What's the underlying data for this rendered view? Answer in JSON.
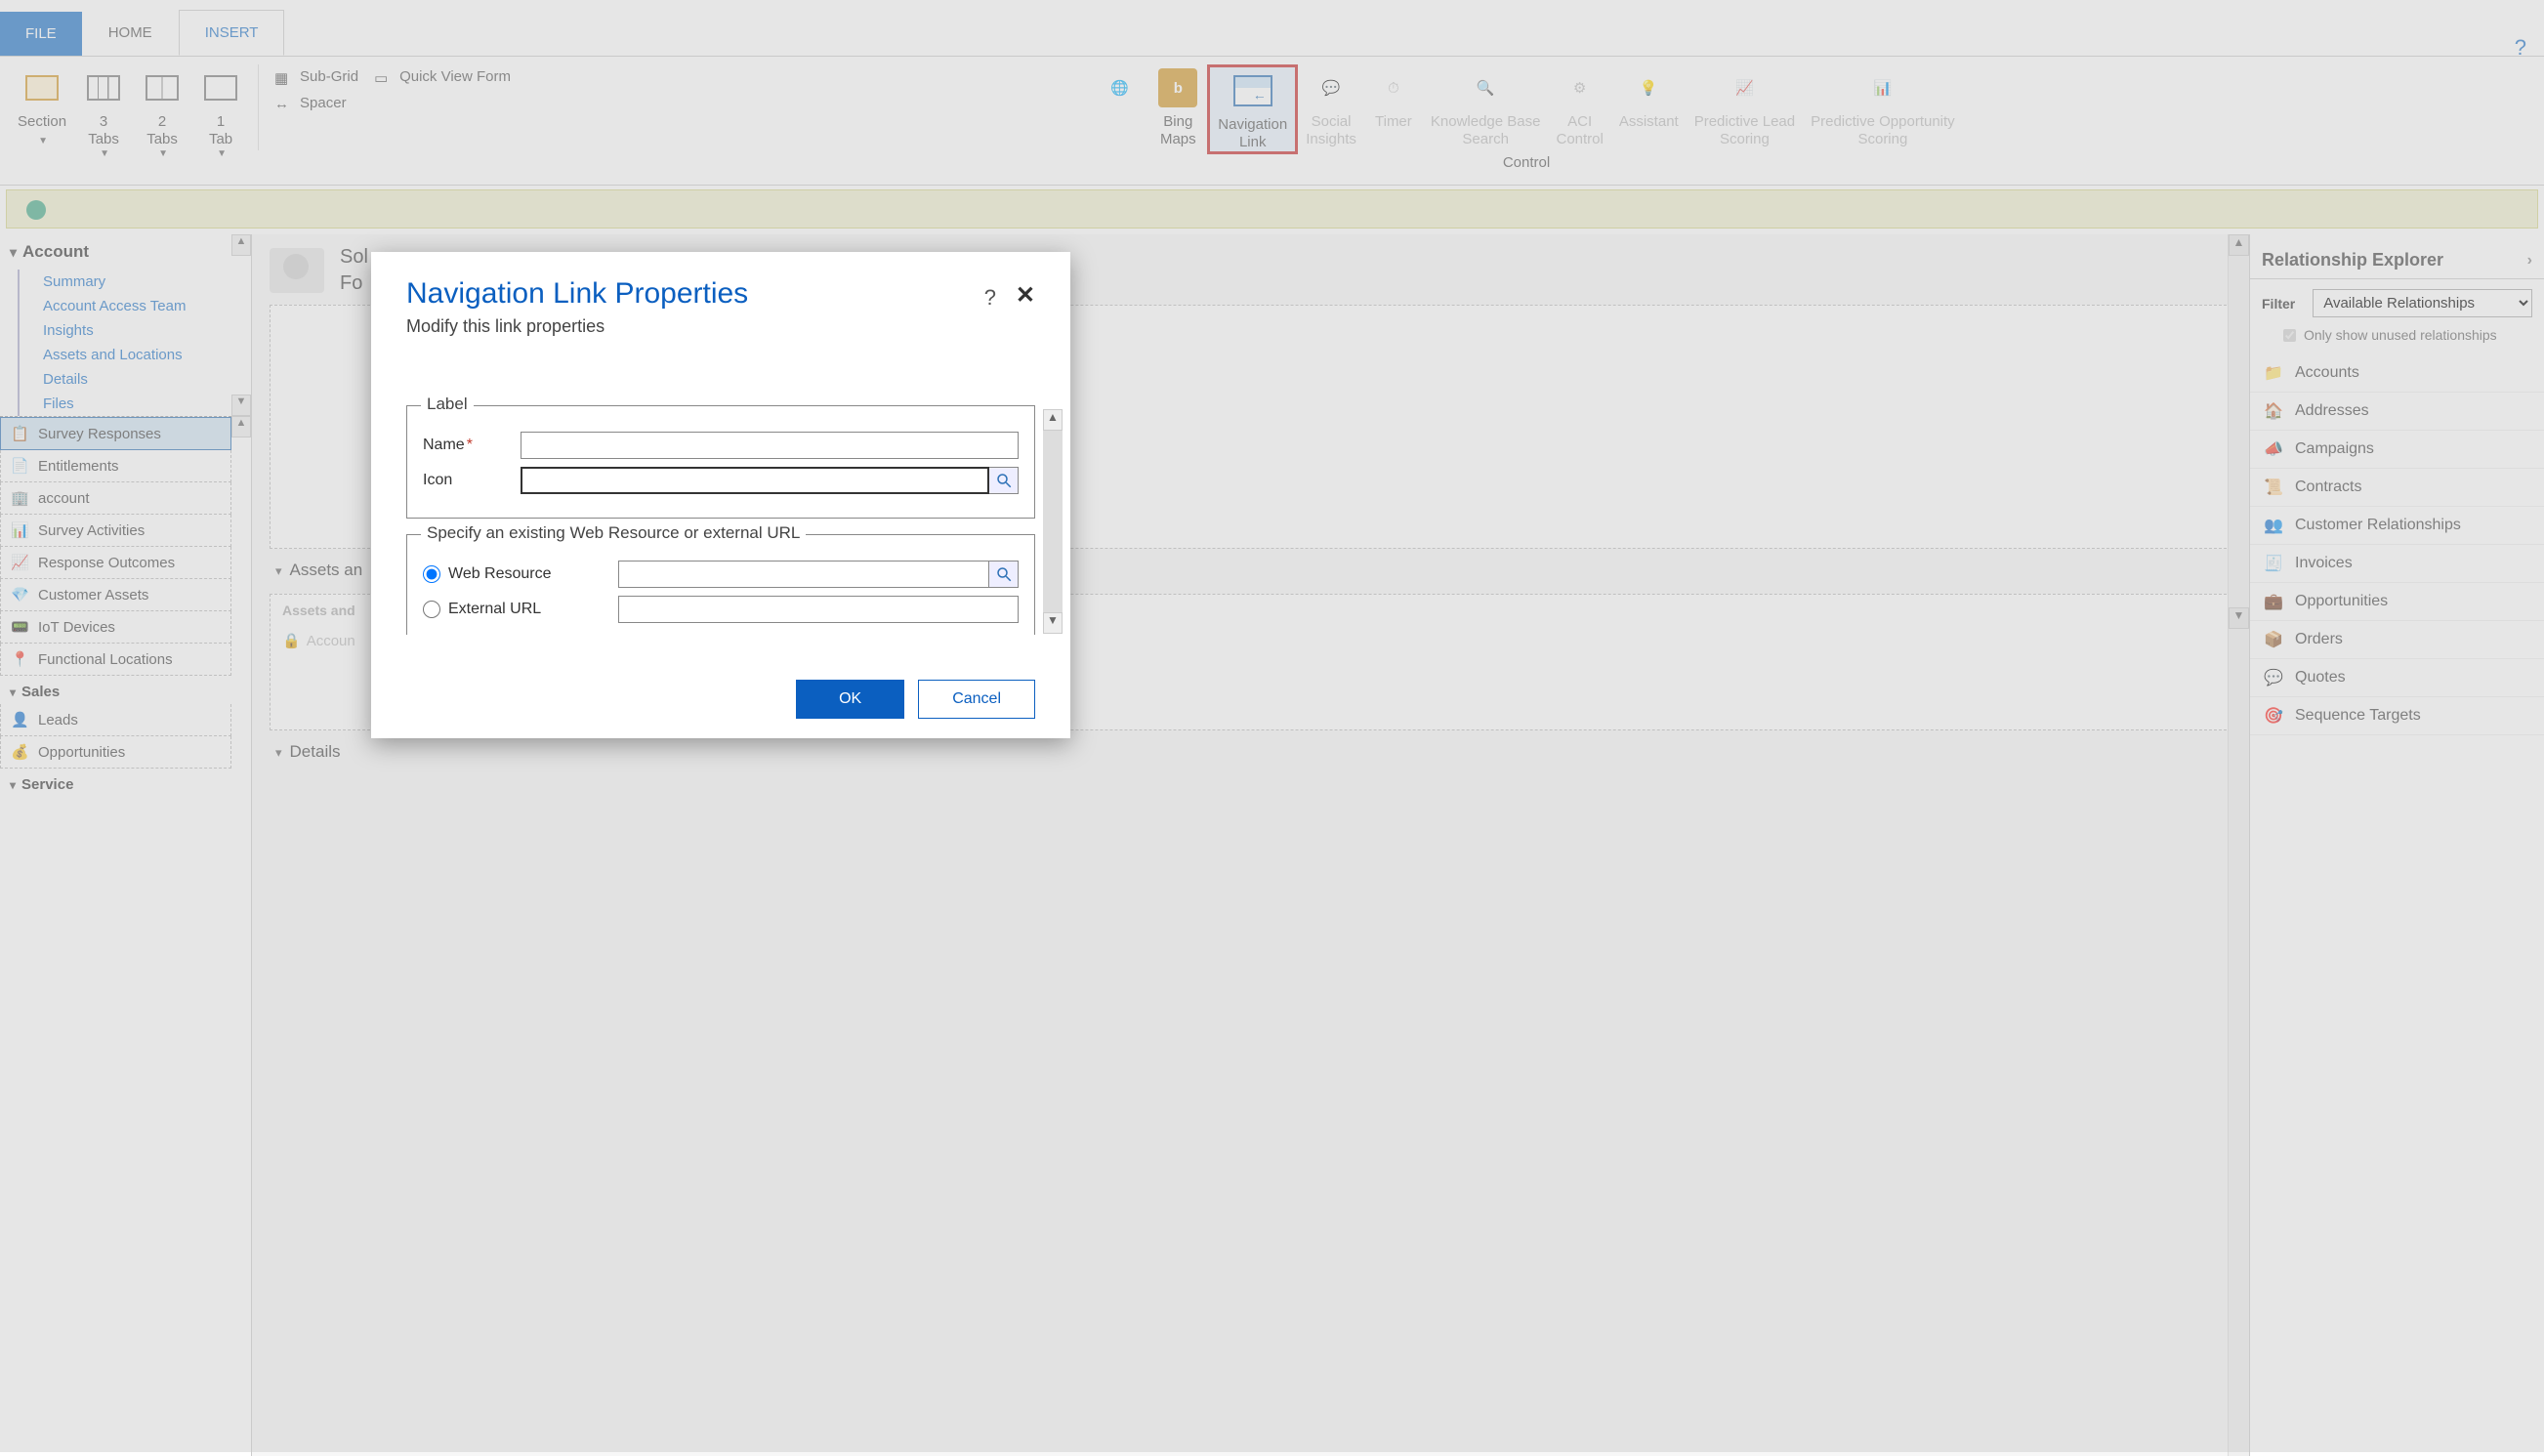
{
  "tabs": {
    "file": "FILE",
    "home": "HOME",
    "insert": "INSERT"
  },
  "ribbon": {
    "section": "Section",
    "tabs3": "3\nTabs",
    "tabs2": "2\nTabs",
    "tabs1": "1\nTab",
    "subgrid": "Sub-Grid",
    "spacer": "Spacer",
    "quickview": "Quick View Form",
    "bingmaps": "Bing\nMaps",
    "navlink": "Navigation\nLink",
    "social": "Social\nInsights",
    "timer": "Timer",
    "kbsearch": "Knowledge Base\nSearch",
    "aci": "ACI\nControl",
    "assistant": "Assistant",
    "leadscore": "Predictive Lead\nScoring",
    "oppscore": "Predictive Opportunity\nScoring",
    "grouplabel": "Control"
  },
  "left": {
    "account_header": "Account",
    "links": [
      "Summary",
      "Account Access Team",
      "Insights",
      "Assets and Locations",
      "Details",
      "Files"
    ],
    "nav_items": [
      "Survey Responses",
      "Entitlements",
      "account",
      "Survey Activities",
      "Response Outcomes",
      "Customer Assets",
      "IoT Devices",
      "Functional Locations"
    ],
    "sales_header": "Sales",
    "sales_items": [
      "Leads",
      "Opportunities"
    ],
    "service_header": "Service"
  },
  "center": {
    "solution_prefix": "Sol",
    "form_prefix": "Fo",
    "section1": "Assets an",
    "sub1": "Assets and",
    "locked": "Accoun",
    "section2": "Details"
  },
  "right": {
    "header": "Relationship Explorer",
    "filter_label": "Filter",
    "filter_value": "Available Relationships",
    "chk_label": "Only show unused relationships",
    "items": [
      "Accounts",
      "Addresses",
      "Campaigns",
      "Contracts",
      "Customer Relationships",
      "Invoices",
      "Opportunities",
      "Orders",
      "Quotes",
      "Sequence Targets"
    ]
  },
  "dialog": {
    "title": "Navigation Link Properties",
    "subtitle": "Modify this link properties",
    "legend_label": "Label",
    "name_label": "Name",
    "icon_label": "Icon",
    "legend_resource": "Specify an existing Web Resource or external URL",
    "webresource": "Web Resource",
    "externalurl": "External URL",
    "ok": "OK",
    "cancel": "Cancel"
  }
}
